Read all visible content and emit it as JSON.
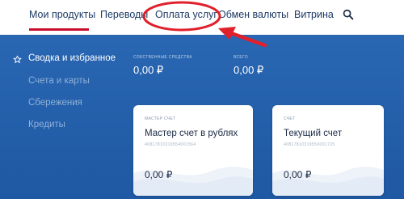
{
  "nav": {
    "tabs": [
      {
        "label": "Мои продукты"
      },
      {
        "label": "Переводы"
      },
      {
        "label": "Оплата услуг"
      },
      {
        "label": "Обмен валюты"
      },
      {
        "label": "Витрина"
      }
    ],
    "search_icon": "search-icon"
  },
  "sidebar": {
    "items": [
      {
        "label": "Сводка и избранное"
      },
      {
        "label": "Счета и карты"
      },
      {
        "label": "Сбережения"
      },
      {
        "label": "Кредиты"
      }
    ]
  },
  "summary": {
    "own_funds": {
      "label": "СОБСТВЕННЫЕ СРЕДСТВА",
      "value": "0,00 ₽"
    },
    "total": {
      "label": "ВСЕГО",
      "value": "0,00 ₽"
    }
  },
  "cards": [
    {
      "label": "МАСТЕР СЧЕТ",
      "title": "Мастер счет в рублях",
      "account": "40817810319554001564",
      "balance": "0,00 ₽"
    },
    {
      "label": "СЧЕТ",
      "title": "Текущий счет",
      "account": "40817810319550001725",
      "balance": "0,00 ₽"
    }
  ],
  "colors": {
    "annotation": "#e0202b",
    "active_underline": "#c8102e",
    "panel": "#2460ab"
  }
}
